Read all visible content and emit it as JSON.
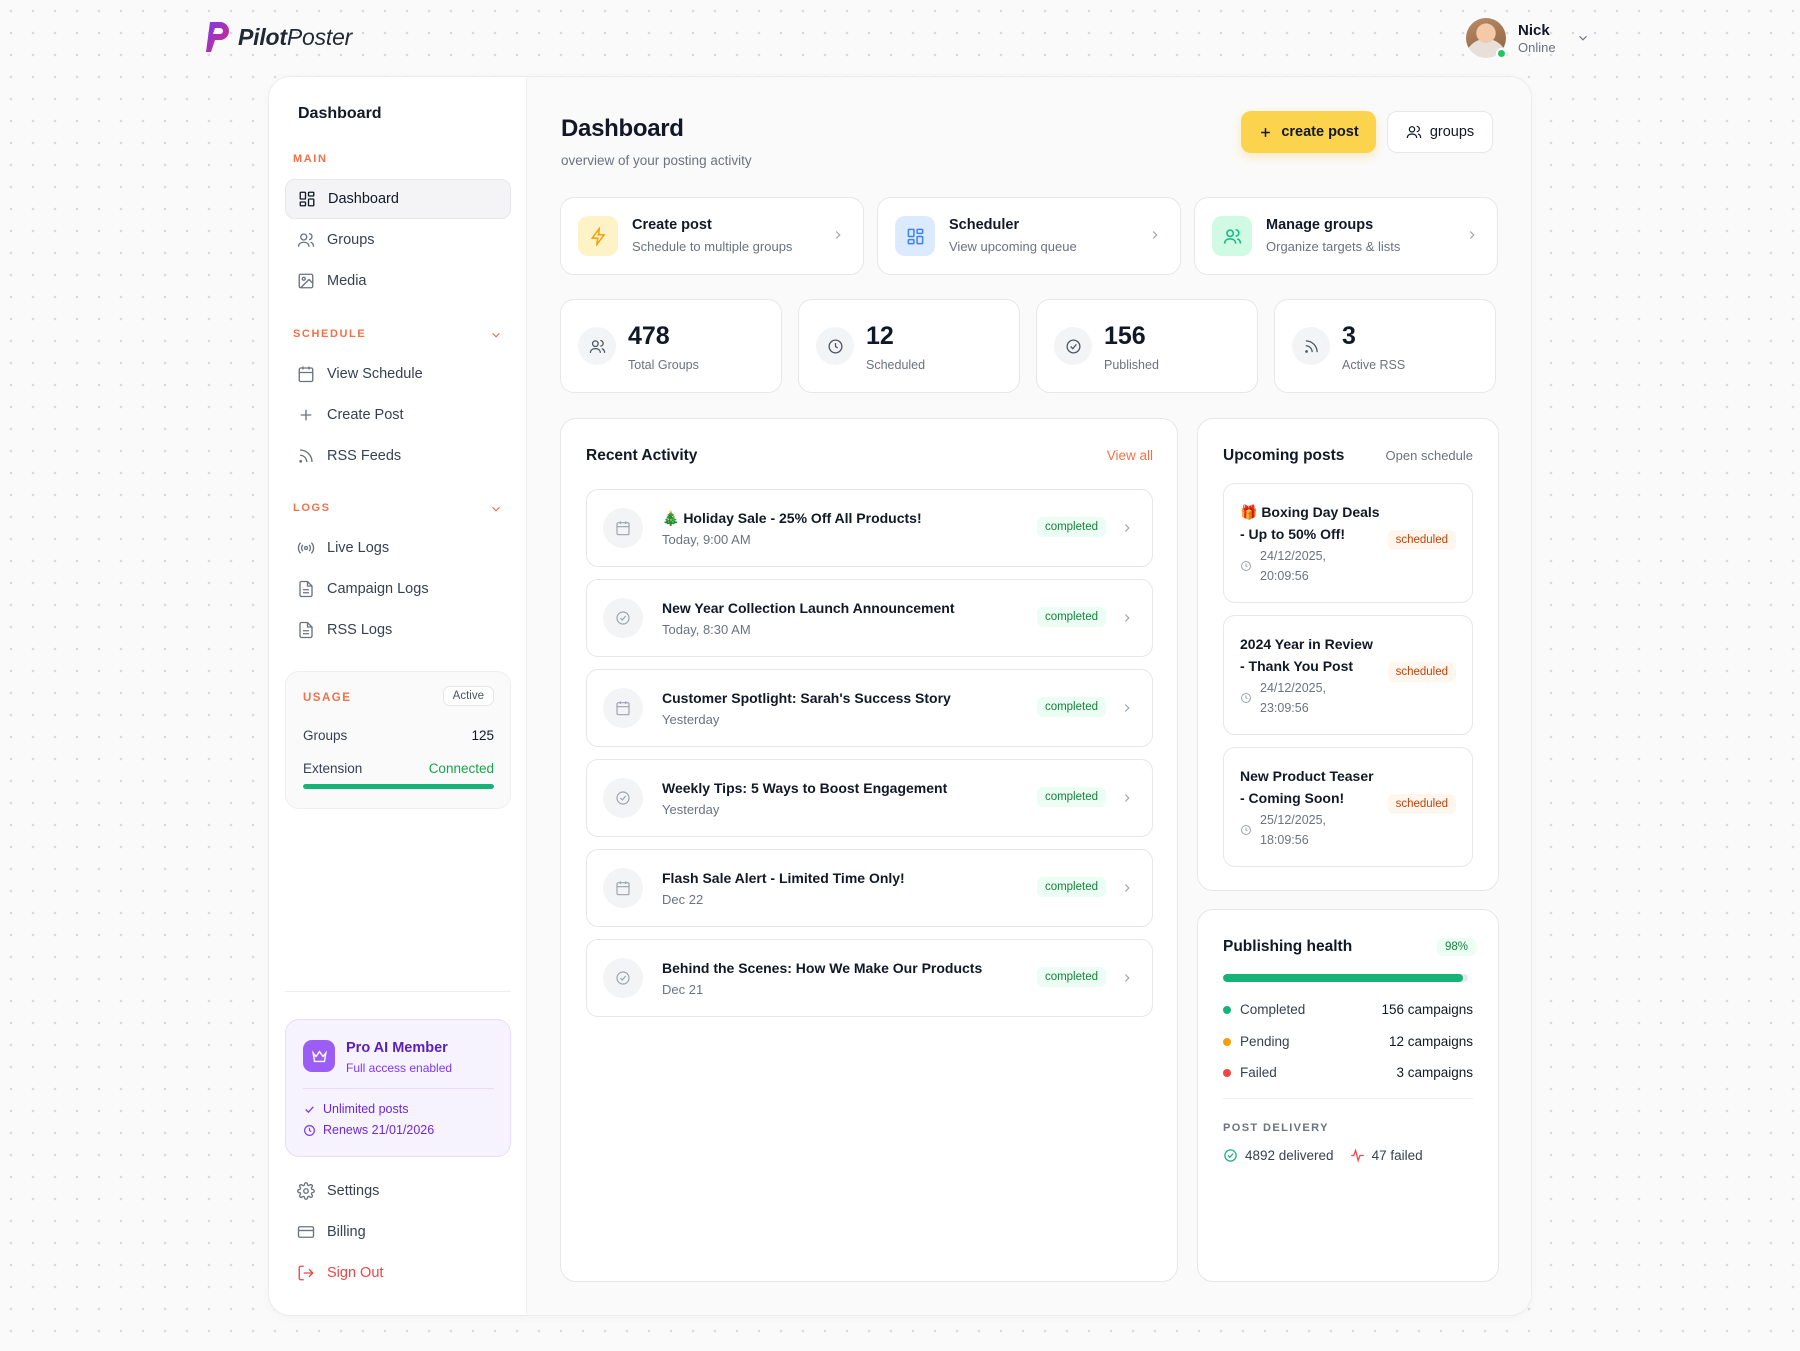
{
  "brand": {
    "name_bold": "Pilot",
    "name_rest": "Poster"
  },
  "user": {
    "name": "Nick",
    "status": "Online"
  },
  "sidebar": {
    "title": "Dashboard",
    "section_main": "MAIN",
    "main_items": [
      {
        "label": "Dashboard",
        "icon": "dashboard-grid-icon",
        "active": true
      },
      {
        "label": "Groups",
        "icon": "users-icon"
      },
      {
        "label": "Media",
        "icon": "image-icon"
      }
    ],
    "section_schedule": "SCHEDULE",
    "schedule_items": [
      {
        "label": "View Schedule",
        "icon": "calendar-icon"
      },
      {
        "label": "Create Post",
        "icon": "plus-icon"
      },
      {
        "label": "RSS Feeds",
        "icon": "rss-icon"
      }
    ],
    "section_logs": "LOGS",
    "log_items": [
      {
        "label": "Live Logs",
        "icon": "broadcast-icon"
      },
      {
        "label": "Campaign Logs",
        "icon": "document-icon"
      },
      {
        "label": "RSS Logs",
        "icon": "document-icon"
      }
    ],
    "usage": {
      "label": "USAGE",
      "badge": "Active",
      "groups_label": "Groups",
      "groups_value": "125",
      "extension_label": "Extension",
      "extension_value": "Connected",
      "progress": 1.0
    },
    "pro": {
      "title": "Pro AI Member",
      "subtitle": "Full access enabled",
      "line1": "Unlimited posts",
      "line2": "Renews 21/01/2026"
    },
    "bottom_items": [
      {
        "label": "Settings",
        "icon": "gear-icon"
      },
      {
        "label": "Billing",
        "icon": "credit-card-icon"
      },
      {
        "label": "Sign Out",
        "icon": "sign-out-icon"
      }
    ]
  },
  "main": {
    "title": "Dashboard",
    "subtitle": "overview of your posting activity",
    "create_label": "create post",
    "groups_label": "groups",
    "quick_actions": [
      {
        "title": "Create post",
        "sub": "Schedule to multiple groups",
        "icon": "lightning-icon",
        "color": "#f59e0b"
      },
      {
        "title": "Scheduler",
        "sub": "View upcoming queue",
        "icon": "grid-icon",
        "color": "#3b82f6"
      },
      {
        "title": "Manage groups",
        "sub": "Organize targets & lists",
        "icon": "users-icon",
        "color": "#10b981"
      }
    ],
    "stats": [
      {
        "value": "478",
        "label": "Total Groups",
        "icon": "users-icon"
      },
      {
        "value": "12",
        "label": "Scheduled",
        "icon": "clock-icon"
      },
      {
        "value": "156",
        "label": "Published",
        "icon": "check-circle-icon"
      },
      {
        "value": "3",
        "label": "Active RSS",
        "icon": "rss-icon"
      }
    ],
    "activity": {
      "title": "Recent Activity",
      "view_all": "View all",
      "items": [
        {
          "title": "🎄 Holiday Sale - 25% Off All Products!",
          "time": "Today, 9:00 AM",
          "status": "completed",
          "icon": "calendar-icon"
        },
        {
          "title": "New Year Collection Launch Announcement",
          "time": "Today, 8:30 AM",
          "status": "completed",
          "icon": "check-circle-icon"
        },
        {
          "title": "Customer Spotlight: Sarah's Success Story",
          "time": "Yesterday",
          "status": "completed",
          "icon": "calendar-icon"
        },
        {
          "title": "Weekly Tips: 5 Ways to Boost Engagement",
          "time": "Yesterday",
          "status": "completed",
          "icon": "check-circle-icon"
        },
        {
          "title": "Flash Sale Alert - Limited Time Only!",
          "time": "Dec 22",
          "status": "completed",
          "icon": "calendar-icon"
        },
        {
          "title": "Behind the Scenes: How We Make Our Products",
          "time": "Dec 21",
          "status": "completed",
          "icon": "check-circle-icon"
        }
      ]
    },
    "upcoming": {
      "title": "Upcoming posts",
      "open_schedule": "Open schedule",
      "items": [
        {
          "title": "🎁 Boxing Day Deals - Up to 50% Off!",
          "date": "24/12/2025, 20:09:56",
          "status": "scheduled"
        },
        {
          "title": "2024 Year in Review - Thank You Post",
          "date": "24/12/2025, 23:09:56",
          "status": "scheduled"
        },
        {
          "title": "New Product Teaser - Coming Soon!",
          "date": "25/12/2025, 18:09:56",
          "status": "scheduled"
        }
      ]
    },
    "health": {
      "title": "Publishing health",
      "percent": "98%",
      "fill": 0.98,
      "rows": [
        {
          "label": "Completed",
          "value": "156 campaigns",
          "color": "#16b378"
        },
        {
          "label": "Pending",
          "value": "12 campaigns",
          "color": "#f59e0b"
        },
        {
          "label": "Failed",
          "value": "3 campaigns",
          "color": "#ef4444"
        }
      ],
      "delivery_label": "POST DELIVERY",
      "delivered": "4892 delivered",
      "failed": "47 failed"
    }
  }
}
